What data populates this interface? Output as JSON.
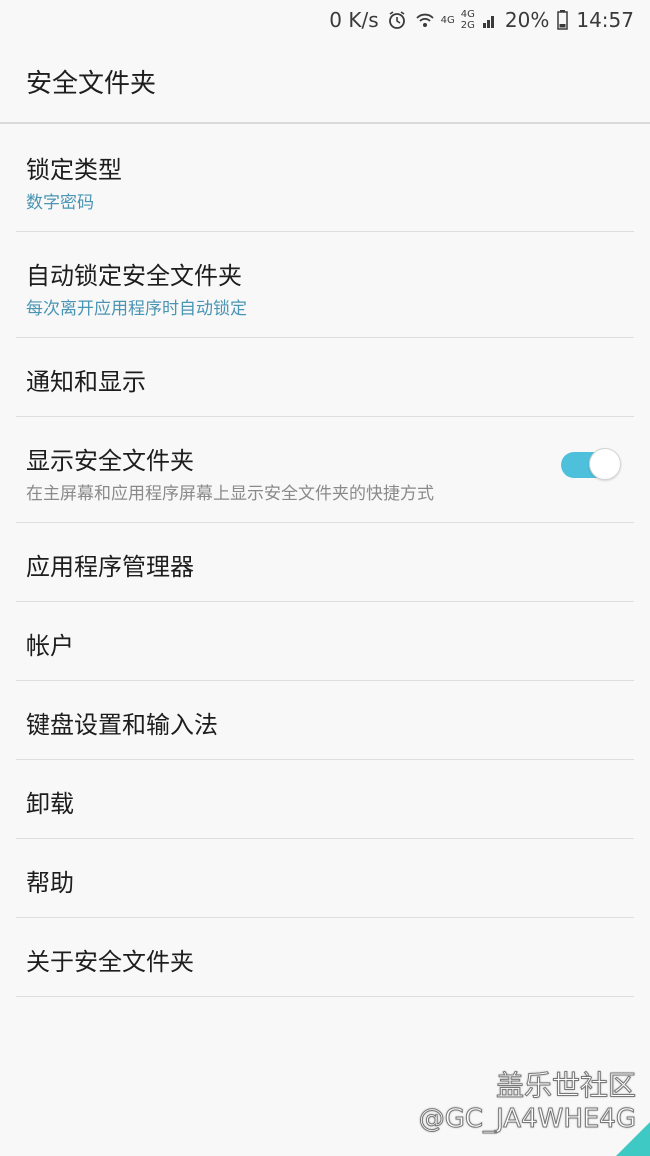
{
  "status": {
    "speed": "0 K/s",
    "net1": "4G",
    "net2a": "4G",
    "net2b": "2G",
    "battery": "20%",
    "time": "14:57"
  },
  "appbar": {
    "title": "安全文件夹"
  },
  "settings": [
    {
      "label": "锁定类型",
      "sub": "数字密码"
    },
    {
      "label": "自动锁定安全文件夹",
      "sub": "每次离开应用程序时自动锁定"
    },
    {
      "label": "通知和显示"
    },
    {
      "label": "显示安全文件夹",
      "sub": "在主屏幕和应用程序屏幕上显示安全文件夹的快捷方式",
      "toggle_on": true
    },
    {
      "label": "应用程序管理器"
    },
    {
      "label": "帐户"
    },
    {
      "label": "键盘设置和输入法"
    },
    {
      "label": "卸载"
    },
    {
      "label": "帮助"
    },
    {
      "label": "关于安全文件夹"
    }
  ],
  "watermark": {
    "line1": "盖乐世社区",
    "line2": "@GC_JA4WHE4G"
  },
  "colors": {
    "accent": "#4fc0db",
    "subtext": "#4a95b3",
    "background": "#f8f8f8"
  }
}
